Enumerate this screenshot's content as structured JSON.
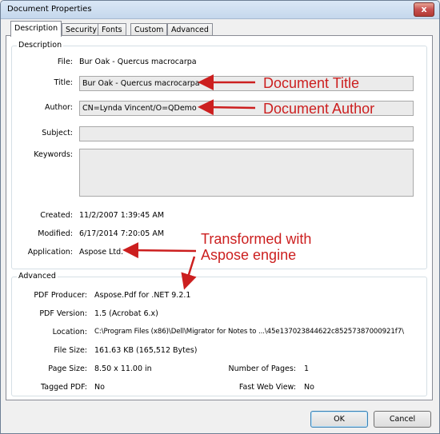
{
  "window": {
    "title": "Document Properties",
    "close_glyph": "x"
  },
  "tabs": [
    "Description",
    "Security",
    "Fonts",
    "Custom",
    "Advanced"
  ],
  "description": {
    "group_label": "Description",
    "file_label": "File:",
    "file_value": "Bur Oak - Quercus macrocarpa",
    "title_label": "Title:",
    "title_value": "Bur Oak - Quercus macrocarpa",
    "author_label": "Author:",
    "author_value": "CN=Lynda Vincent/O=QDemo",
    "subject_label": "Subject:",
    "subject_value": "",
    "keywords_label": "Keywords:",
    "keywords_value": "",
    "created_label": "Created:",
    "created_value": "11/2/2007 1:39:45 AM",
    "modified_label": "Modified:",
    "modified_value": "6/17/2014 7:20:05 AM",
    "application_label": "Application:",
    "application_value": "Aspose Ltd."
  },
  "advanced": {
    "group_label": "Advanced",
    "producer_label": "PDF Producer:",
    "producer_value": "Aspose.Pdf for .NET 9.2.1",
    "version_label": "PDF Version:",
    "version_value": "1.5 (Acrobat 6.x)",
    "location_label": "Location:",
    "location_value": "C:\\Program Files (x86)\\Dell\\Migrator for Notes to ...\\45e137023844622c85257387000921f7\\",
    "filesize_label": "File Size:",
    "filesize_value": "161.63 KB (165,512 Bytes)",
    "pagesize_label": "Page Size:",
    "pagesize_value": "8.50 x 11.00 in",
    "numpages_label": "Number of Pages:",
    "numpages_value": "1",
    "tagged_label": "Tagged PDF:",
    "tagged_value": "No",
    "fastweb_label": "Fast Web View:",
    "fastweb_value": "No"
  },
  "annotations": {
    "doc_title": "Document Title",
    "doc_author": "Document Author",
    "transformed_line1": "Transformed with",
    "transformed_line2": "Aspose engine",
    "color": "#cc1f1f"
  },
  "buttons": {
    "ok": "OK",
    "cancel": "Cancel"
  }
}
